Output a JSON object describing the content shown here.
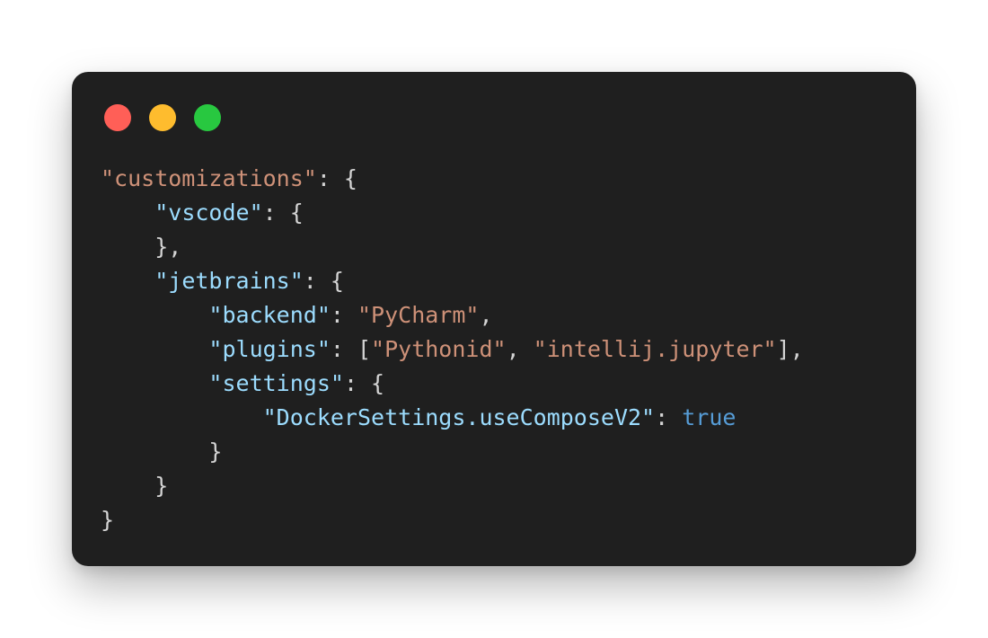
{
  "window": {
    "controls": [
      {
        "name": "close-dot",
        "color": "#ff5f57"
      },
      {
        "name": "minimize-dot",
        "color": "#febc2e"
      },
      {
        "name": "zoom-dot",
        "color": "#28c840"
      }
    ]
  },
  "colors": {
    "background": "#1f1f1f",
    "key": "#9cdcfe",
    "string": "#ce9178",
    "boolean": "#569cd6",
    "punctuation": "#d4d4d4"
  },
  "code": {
    "lines": [
      {
        "indent": 0,
        "tokens": [
          {
            "t": "\"customizations\"",
            "k": "string"
          },
          {
            "t": ": {",
            "k": "punctuation"
          }
        ]
      },
      {
        "indent": 1,
        "tokens": [
          {
            "t": "\"vscode\"",
            "k": "key"
          },
          {
            "t": ": {",
            "k": "punctuation"
          }
        ]
      },
      {
        "indent": 1,
        "tokens": [
          {
            "t": "},",
            "k": "punctuation"
          }
        ]
      },
      {
        "indent": 1,
        "tokens": [
          {
            "t": "\"jetbrains\"",
            "k": "key"
          },
          {
            "t": ": {",
            "k": "punctuation"
          }
        ]
      },
      {
        "indent": 2,
        "tokens": [
          {
            "t": "\"backend\"",
            "k": "key"
          },
          {
            "t": ": ",
            "k": "punctuation"
          },
          {
            "t": "\"PyCharm\"",
            "k": "string"
          },
          {
            "t": ",",
            "k": "punctuation"
          }
        ]
      },
      {
        "indent": 2,
        "tokens": [
          {
            "t": "\"plugins\"",
            "k": "key"
          },
          {
            "t": ": [",
            "k": "punctuation"
          },
          {
            "t": "\"Pythonid\"",
            "k": "string"
          },
          {
            "t": ", ",
            "k": "punctuation"
          },
          {
            "t": "\"intellij.jupyter\"",
            "k": "string"
          },
          {
            "t": "],",
            "k": "punctuation"
          }
        ]
      },
      {
        "indent": 2,
        "tokens": [
          {
            "t": "\"settings\"",
            "k": "key"
          },
          {
            "t": ": {",
            "k": "punctuation"
          }
        ]
      },
      {
        "indent": 3,
        "tokens": [
          {
            "t": "\"DockerSettings.useComposeV2\"",
            "k": "key"
          },
          {
            "t": ": ",
            "k": "punctuation"
          },
          {
            "t": "true",
            "k": "boolean"
          }
        ]
      },
      {
        "indent": 2,
        "tokens": [
          {
            "t": "}",
            "k": "punctuation"
          }
        ]
      },
      {
        "indent": 1,
        "tokens": [
          {
            "t": "}",
            "k": "punctuation"
          }
        ]
      },
      {
        "indent": 0,
        "tokens": [
          {
            "t": "}",
            "k": "punctuation"
          }
        ]
      }
    ]
  }
}
